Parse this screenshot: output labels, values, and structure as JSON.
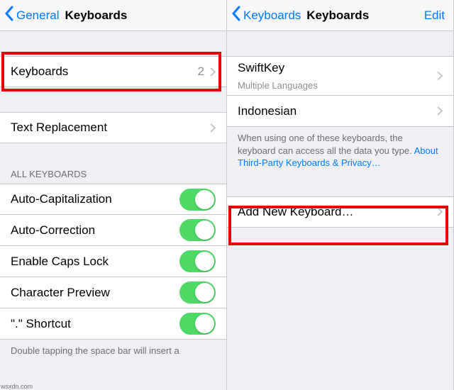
{
  "left": {
    "nav": {
      "back": "General",
      "title": "Keyboards"
    },
    "rows": {
      "keyboards": {
        "label": "Keyboards",
        "count": "2"
      },
      "text_replacement": {
        "label": "Text Replacement"
      }
    },
    "section_header": "ALL KEYBOARDS",
    "toggles": {
      "auto_cap": "Auto-Capitalization",
      "auto_correct": "Auto-Correction",
      "caps_lock": "Enable Caps Lock",
      "char_preview": "Character Preview",
      "shortcut": "\".\" Shortcut"
    },
    "footer": "Double tapping the space bar will insert a"
  },
  "right": {
    "nav": {
      "back": "Keyboards",
      "title": "Keyboards",
      "edit": "Edit"
    },
    "keyboards": {
      "swiftkey": {
        "label": "SwiftKey",
        "sub": "Multiple Languages"
      },
      "indonesian": {
        "label": "Indonesian"
      }
    },
    "disclosure": {
      "text": "When using one of these keyboards, the keyboard can access all the data you type. ",
      "link": "About Third-Party Keyboards & Privacy…"
    },
    "add": "Add New Keyboard…"
  },
  "watermark": "wsxdn.com"
}
